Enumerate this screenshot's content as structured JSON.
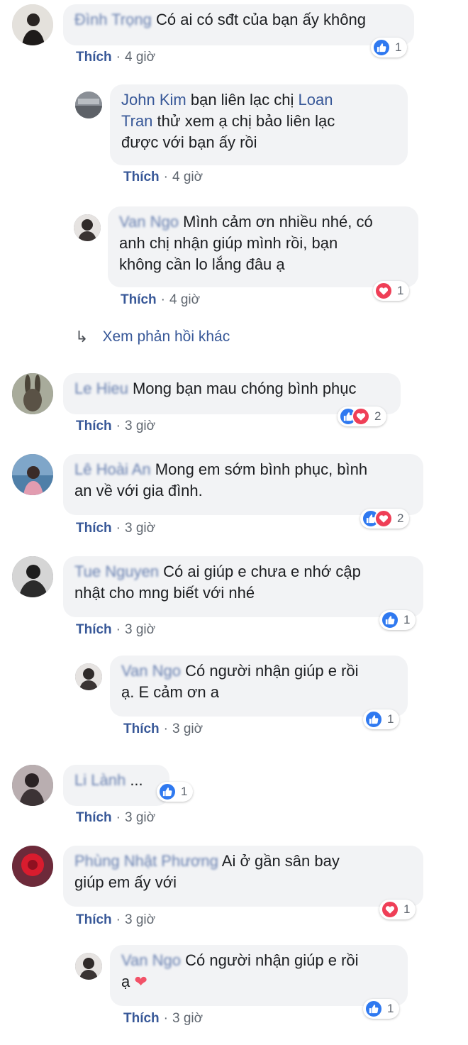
{
  "comments": [
    {
      "author": "Đình Trọng",
      "text": "Có ai có sđt của bạn ấy không",
      "like": "Thích",
      "time": "4 giờ",
      "count": "1"
    },
    {
      "author": "John Kim",
      "text_a": "bạn liên lạc chị ",
      "mention_a": "Loan",
      "mention_b": "Tran",
      "text_b": " thử xem ạ chị bảo liên lạc",
      "text_c": "được với bạn ấy rồi",
      "like": "Thích",
      "time": "4 giờ"
    },
    {
      "author": "Van Ngo",
      "text_a": "Mình cảm ơn nhiều nhé, có",
      "text_b": "anh chị nhận giúp mình rồi, bạn",
      "text_c": "không cần lo lắng đâu ạ",
      "like": "Thích",
      "time": "4 giờ",
      "count": "1"
    },
    {
      "author": "Le Hieu",
      "text": "Mong bạn mau chóng bình phục",
      "like": "Thích",
      "time": "3 giờ",
      "count": "2"
    },
    {
      "author": "Lê Hoài An",
      "text_a": "Mong em sớm bình phục, bình",
      "text_b": "an về với gia đình.",
      "like": "Thích",
      "time": "3 giờ",
      "count": "2"
    },
    {
      "author": "Tue Nguyen",
      "text_a": "Có ai giúp e chưa e nhớ cập",
      "text_b": "nhật cho mng biết với nhé",
      "like": "Thích",
      "time": "3 giờ",
      "count": "1"
    },
    {
      "author": "Van Ngo",
      "text_a": "Có người nhận giúp e rồi",
      "text_b": "ạ. E cảm ơn a",
      "like": "Thích",
      "time": "3 giờ",
      "count": "1"
    },
    {
      "author": "Li Lành",
      "text": "...",
      "like": "Thích",
      "time": "3 giờ",
      "count": "1"
    },
    {
      "author": "Phùng Nhật Phương",
      "text_a": "Ai ở gần sân bay",
      "text_b": "giúp em ấy với",
      "like": "Thích",
      "time": "3 giờ",
      "count": "1"
    },
    {
      "author": "Van Ngo",
      "text_a": "Có người nhận giúp e rồi",
      "text_b": "ạ",
      "heart": "❤",
      "like": "Thích",
      "time": "3 giờ",
      "count": "1"
    }
  ],
  "more_replies": "Xem phản hồi khác",
  "dot": "·",
  "icons": {
    "like": "like-icon",
    "love": "love-icon",
    "reply_arrow": "reply-arrow-icon"
  },
  "colors": {
    "link": "#385898",
    "like_blue": "#2f79f0",
    "love_red": "#ef3f57",
    "bubble": "#f2f3f5"
  }
}
